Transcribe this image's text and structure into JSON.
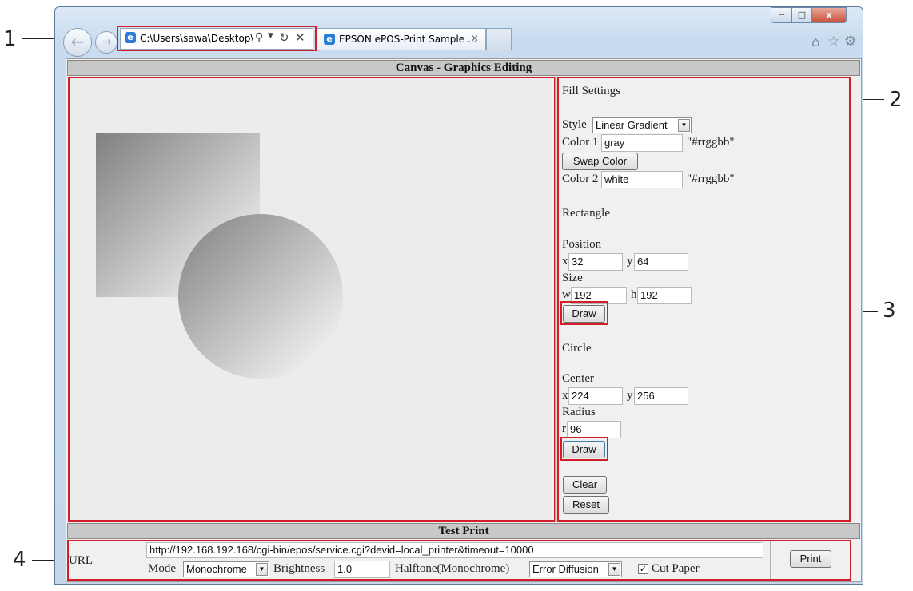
{
  "callouts": {
    "one": "1",
    "two": "2",
    "three": "3",
    "four": "4"
  },
  "browser": {
    "address": "C:\\Users\\sawa\\Desktop\\",
    "tab_title": "EPSON ePOS-Print Sample ...",
    "icons": [
      "ie-icon",
      "search-icon",
      "dropdown-arrow-icon",
      "refresh-icon",
      "stop-icon",
      "home-icon",
      "favorites-star-icon",
      "settings-gear-icon",
      "back-arrow-icon",
      "forward-arrow-icon",
      "minimize-icon",
      "maximize-icon",
      "close-icon"
    ]
  },
  "canvas_section": {
    "title": "Canvas - Graphics Editing"
  },
  "fill": {
    "heading": "Fill Settings",
    "style_label": "Style",
    "style_value": "Linear Gradient",
    "color1_label": "Color 1",
    "color1_value": "gray",
    "color_hint": "\"#rrggbb\"",
    "swap_label": "Swap Color",
    "color2_label": "Color 2",
    "color2_value": "white"
  },
  "rectangle": {
    "heading": "Rectangle",
    "position_label": "Position",
    "x_label": "x",
    "x_value": "32",
    "y_label": "y",
    "y_value": "64",
    "size_label": "Size",
    "w_label": "w",
    "w_value": "192",
    "h_label": "h",
    "h_value": "192",
    "draw_label": "Draw"
  },
  "circle": {
    "heading": "Circle",
    "center_label": "Center",
    "x_label": "x",
    "x_value": "224",
    "y_label": "y",
    "y_value": "256",
    "radius_label": "Radius",
    "r_label": "r",
    "r_value": "96",
    "draw_label": "Draw"
  },
  "actions": {
    "clear_label": "Clear",
    "reset_label": "Reset"
  },
  "test_print": {
    "title": "Test Print",
    "url_label": "URL",
    "url_value": "http://192.168.192.168/cgi-bin/epos/service.cgi?devid=local_printer&timeout=10000",
    "mode_label": "Mode",
    "mode_value": "Monochrome",
    "brightness_label": "Brightness",
    "brightness_value": "1.0",
    "halftone_label": "Halftone(Monochrome)",
    "halftone_value": "Error Diffusion",
    "cut_label": "Cut Paper",
    "cut_checked": true,
    "print_label": "Print"
  },
  "colors": {
    "highlight": "#d01f2a",
    "section_header": "#c8c8c8",
    "panel_bg": "#f0f0f0"
  }
}
